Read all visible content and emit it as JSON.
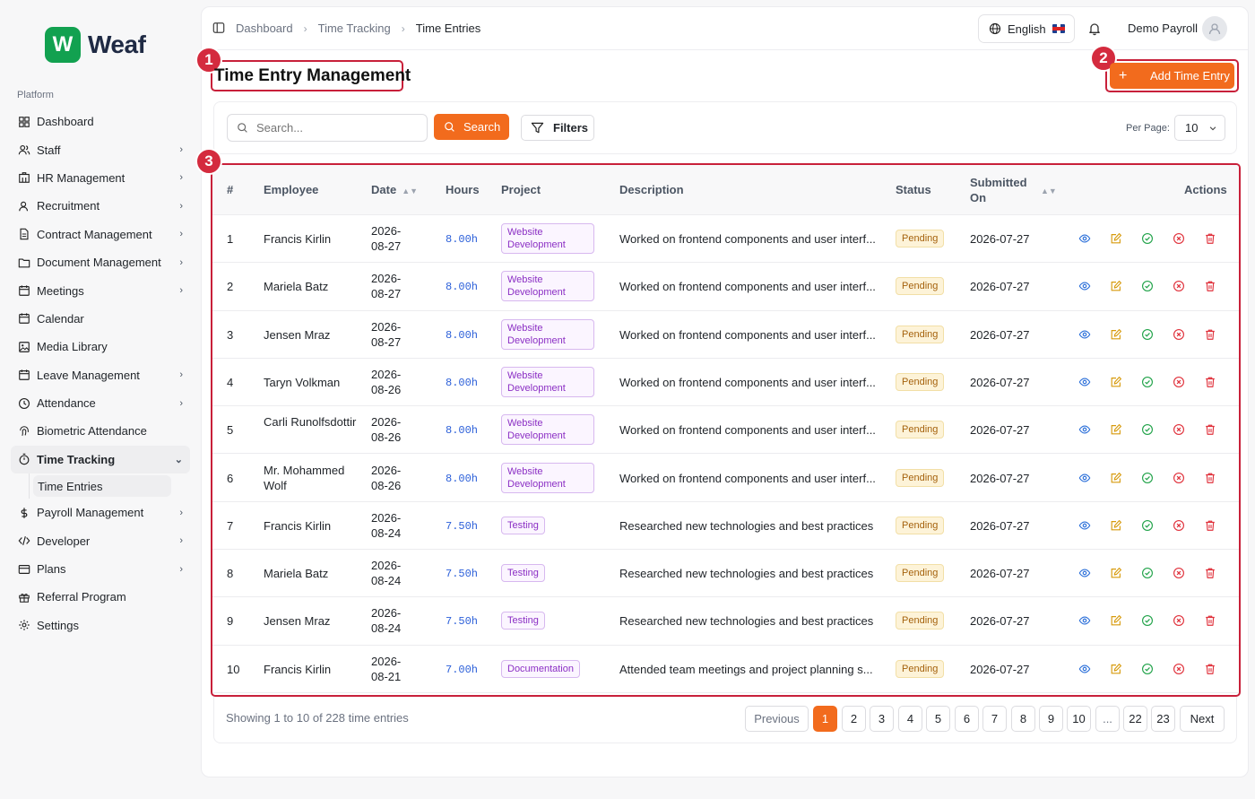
{
  "app": {
    "logo_mark": "W",
    "logo_text": "Weaf"
  },
  "sidebar": {
    "section_label": "Platform",
    "items": [
      {
        "label": "Dashboard",
        "icon": "grid-icon",
        "chevron": false
      },
      {
        "label": "Staff",
        "icon": "users-icon",
        "chevron": true
      },
      {
        "label": "HR Management",
        "icon": "building-icon",
        "chevron": true
      },
      {
        "label": "Recruitment",
        "icon": "user-plus-icon",
        "chevron": true
      },
      {
        "label": "Contract Management",
        "icon": "file-text-icon",
        "chevron": true
      },
      {
        "label": "Document Management",
        "icon": "folder-icon",
        "chevron": true
      },
      {
        "label": "Meetings",
        "icon": "calendar-icon",
        "chevron": true
      },
      {
        "label": "Calendar",
        "icon": "calendar-icon",
        "chevron": false
      },
      {
        "label": "Media Library",
        "icon": "image-icon",
        "chevron": false
      },
      {
        "label": "Leave Management",
        "icon": "calendar-icon",
        "chevron": true
      },
      {
        "label": "Attendance",
        "icon": "clock-icon",
        "chevron": true
      },
      {
        "label": "Biometric Attendance",
        "icon": "fingerprint-icon",
        "chevron": false
      },
      {
        "label": "Time Tracking",
        "icon": "timer-icon",
        "chevron": true,
        "active": true
      },
      {
        "label": "Payroll Management",
        "icon": "dollar-icon",
        "chevron": true
      },
      {
        "label": "Developer",
        "icon": "code-icon",
        "chevron": true
      },
      {
        "label": "Plans",
        "icon": "credit-card-icon",
        "chevron": true
      },
      {
        "label": "Referral Program",
        "icon": "gift-icon",
        "chevron": false
      },
      {
        "label": "Settings",
        "icon": "gear-icon",
        "chevron": false
      }
    ],
    "sub_item": "Time Entries"
  },
  "header": {
    "breadcrumb": [
      "Dashboard",
      "Time Tracking",
      "Time Entries"
    ],
    "language": "English",
    "user_name": "Demo Payroll"
  },
  "page": {
    "title": "Time Entry Management",
    "add_button": "Add Time Entry",
    "annotations": [
      "1",
      "2",
      "3"
    ]
  },
  "toolbar": {
    "search_placeholder": "Search...",
    "search_button": "Search",
    "filters_button": "Filters",
    "per_page_label": "Per Page:",
    "per_page_value": "10"
  },
  "table": {
    "columns": [
      "#",
      "Employee",
      "Date",
      "Hours",
      "Project",
      "Description",
      "Status",
      "Submitted On",
      "Actions"
    ],
    "rows": [
      {
        "num": "1",
        "employee": "Francis Kirlin",
        "date": "2026-08-27",
        "hours": "8.00h",
        "project": "Website Development",
        "description": "Worked on frontend components and user interf...",
        "status": "Pending",
        "submitted": "2026-07-27"
      },
      {
        "num": "2",
        "employee": "Mariela Batz",
        "date": "2026-08-27",
        "hours": "8.00h",
        "project": "Website Development",
        "description": "Worked on frontend components and user interf...",
        "status": "Pending",
        "submitted": "2026-07-27"
      },
      {
        "num": "3",
        "employee": "Jensen Mraz",
        "date": "2026-08-27",
        "hours": "8.00h",
        "project": "Website Development",
        "description": "Worked on frontend components and user interf...",
        "status": "Pending",
        "submitted": "2026-07-27"
      },
      {
        "num": "4",
        "employee": "Taryn Volkman",
        "date": "2026-08-26",
        "hours": "8.00h",
        "project": "Website Development",
        "description": "Worked on frontend components and user interf...",
        "status": "Pending",
        "submitted": "2026-07-27"
      },
      {
        "num": "5",
        "employee": "Carli Runolfsdottir",
        "date": "2026-08-26",
        "hours": "8.00h",
        "project": "Website Development",
        "description": "Worked on frontend components and user interf...",
        "status": "Pending",
        "submitted": "2026-07-27"
      },
      {
        "num": "6",
        "employee": "Mr. Mohammed Wolf",
        "date": "2026-08-26",
        "hours": "8.00h",
        "project": "Website Development",
        "description": "Worked on frontend components and user interf...",
        "status": "Pending",
        "submitted": "2026-07-27"
      },
      {
        "num": "7",
        "employee": "Francis Kirlin",
        "date": "2026-08-24",
        "hours": "7.50h",
        "project": "Testing",
        "description": "Researched new technologies and best practices",
        "status": "Pending",
        "submitted": "2026-07-27"
      },
      {
        "num": "8",
        "employee": "Mariela Batz",
        "date": "2026-08-24",
        "hours": "7.50h",
        "project": "Testing",
        "description": "Researched new technologies and best practices",
        "status": "Pending",
        "submitted": "2026-07-27"
      },
      {
        "num": "9",
        "employee": "Jensen Mraz",
        "date": "2026-08-24",
        "hours": "7.50h",
        "project": "Testing",
        "description": "Researched new technologies and best practices",
        "status": "Pending",
        "submitted": "2026-07-27"
      },
      {
        "num": "10",
        "employee": "Francis Kirlin",
        "date": "2026-08-21",
        "hours": "7.00h",
        "project": "Documentation",
        "description": "Attended team meetings and project planning s...",
        "status": "Pending",
        "submitted": "2026-07-27"
      }
    ]
  },
  "pagination": {
    "summary": "Showing 1 to 10 of 228 time entries",
    "previous": "Previous",
    "pages": [
      "1",
      "2",
      "3",
      "4",
      "5",
      "6",
      "7",
      "8",
      "9",
      "10",
      "...",
      "22",
      "23"
    ],
    "next": "Next"
  },
  "colors": {
    "accent": "#f26b1d",
    "annotation": "#d42b3e",
    "view_icon": "#2b6fd9",
    "edit_icon": "#d79a0c",
    "approve_icon": "#22a34a",
    "reject_icon": "#e0323c",
    "delete_icon": "#e0323c"
  }
}
